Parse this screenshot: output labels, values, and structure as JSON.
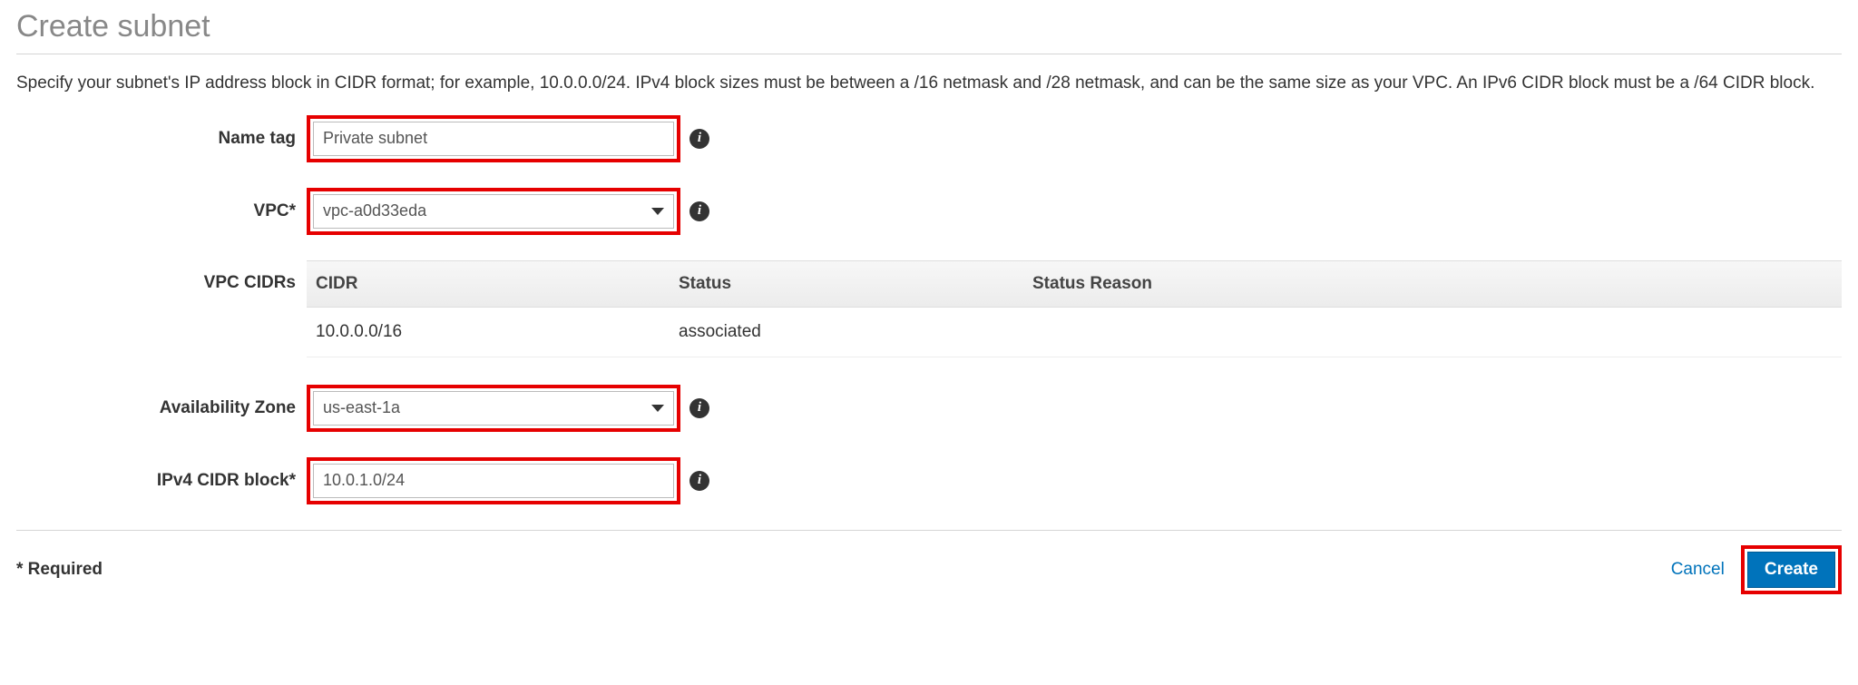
{
  "page": {
    "title": "Create subnet",
    "description": "Specify your subnet's IP address block in CIDR format; for example, 10.0.0.0/24. IPv4 block sizes must be between a /16 netmask and /28 netmask, and can be the same size as your VPC. An IPv6 CIDR block must be a /64 CIDR block."
  },
  "form": {
    "name_tag": {
      "label": "Name tag",
      "value": "Private subnet"
    },
    "vpc": {
      "label": "VPC*",
      "value": "vpc-a0d33eda"
    },
    "vpc_cidrs_label": "VPC CIDRs",
    "az": {
      "label": "Availability Zone",
      "value": "us-east-1a"
    },
    "ipv4_cidr": {
      "label": "IPv4 CIDR block*",
      "value": "10.0.1.0/24"
    }
  },
  "cidr_table": {
    "headers": {
      "cidr": "CIDR",
      "status": "Status",
      "reason": "Status Reason"
    },
    "rows": [
      {
        "cidr": "10.0.0.0/16",
        "status": "associated",
        "reason": ""
      }
    ]
  },
  "footer": {
    "required": "* Required",
    "cancel": "Cancel",
    "create": "Create"
  },
  "info_glyph": "i"
}
